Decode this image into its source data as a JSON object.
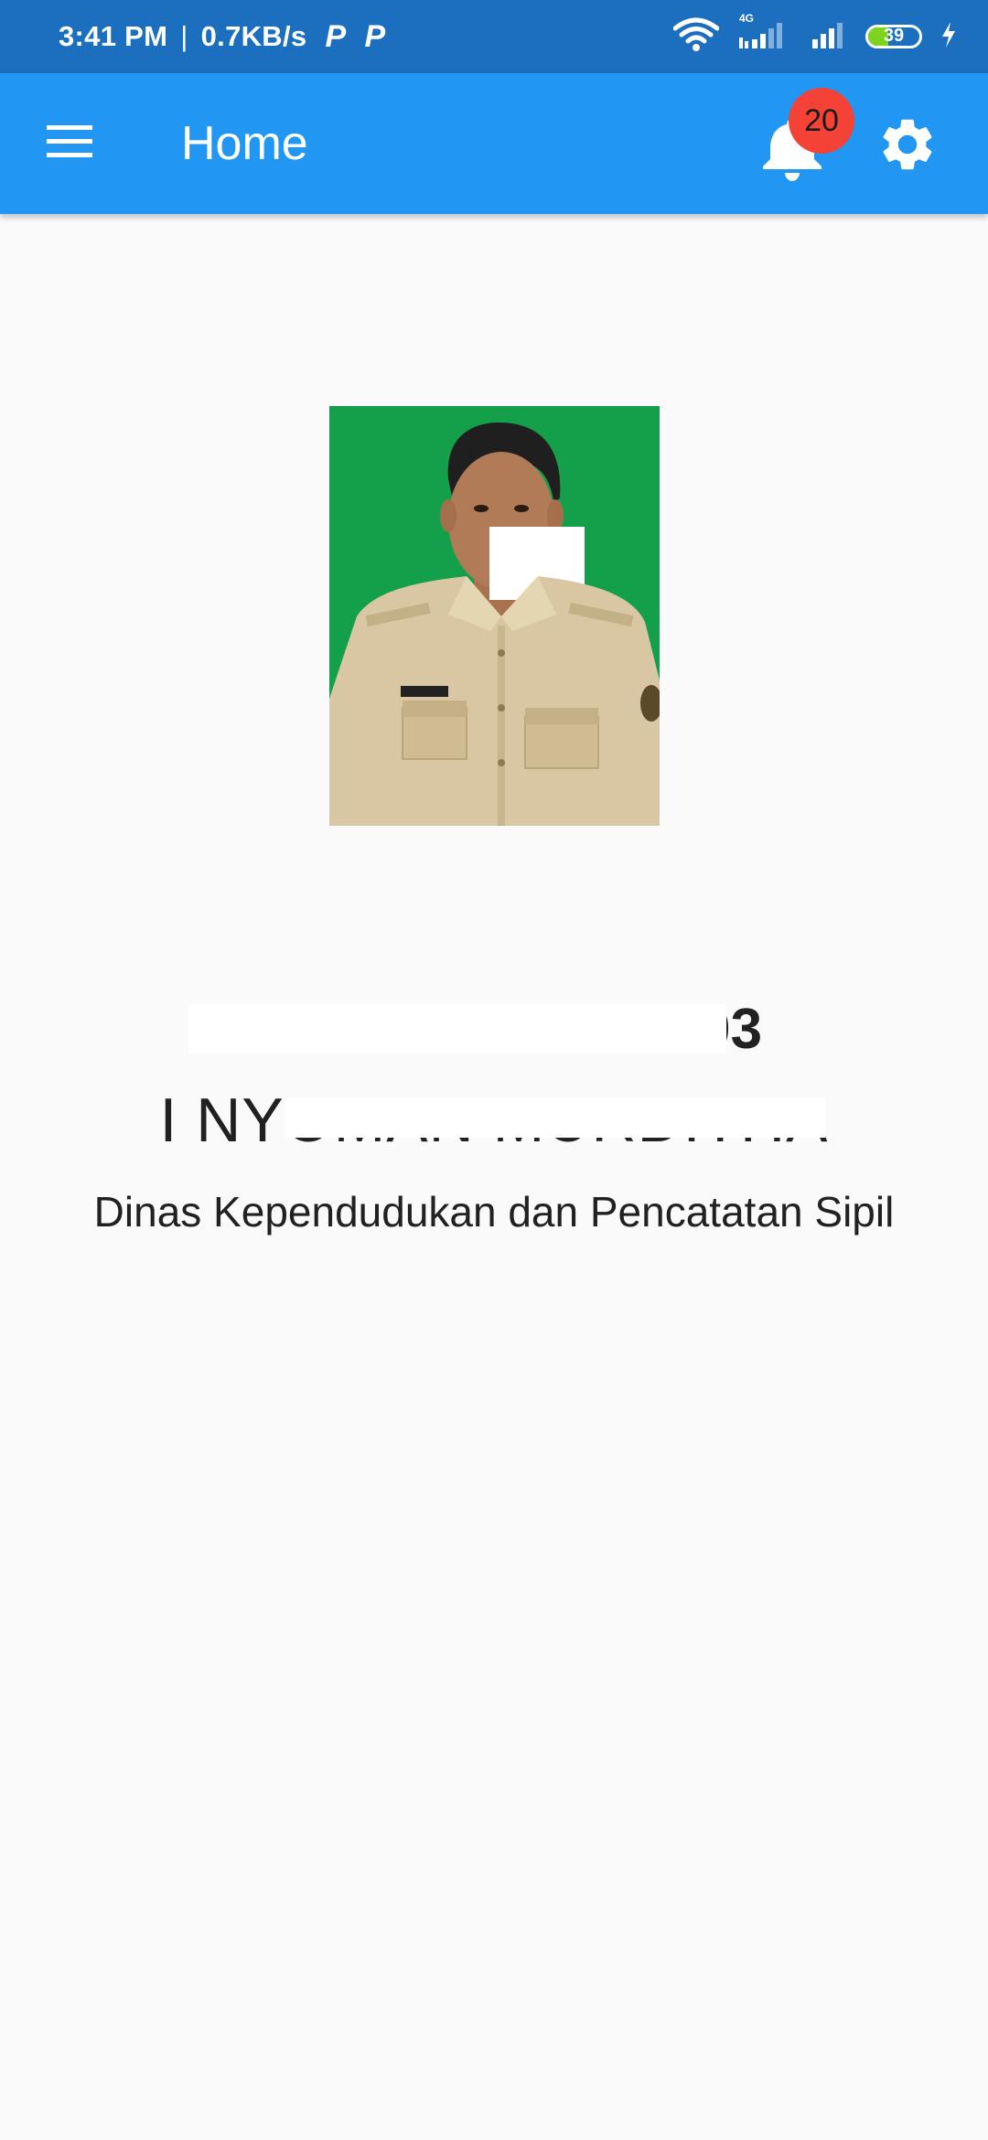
{
  "status_bar": {
    "time": "3:41 PM",
    "speed": "0.7KB/s",
    "app_icons": [
      "P",
      "P"
    ],
    "network_label": "4G",
    "battery_percent": "39",
    "battery_level": 0.39,
    "icons": [
      "wifi-icon",
      "signal-4g-icon",
      "signal-icon",
      "battery-icon",
      "charging-icon"
    ]
  },
  "app_bar": {
    "title": "Home",
    "notification_count": "20",
    "colors": {
      "app_bar": "#2196f3",
      "status_bar": "#1c6fbf",
      "badge": "#f44336"
    },
    "icons": [
      "menu-icon",
      "bell-icon",
      "gear-icon"
    ]
  },
  "profile": {
    "photo_background": "#14a04a",
    "nip_visible": "003",
    "name_visible": "I NYOMAN MURDITHA",
    "agency": "Dinas Kependudukan dan Pencatatan Sipil"
  }
}
